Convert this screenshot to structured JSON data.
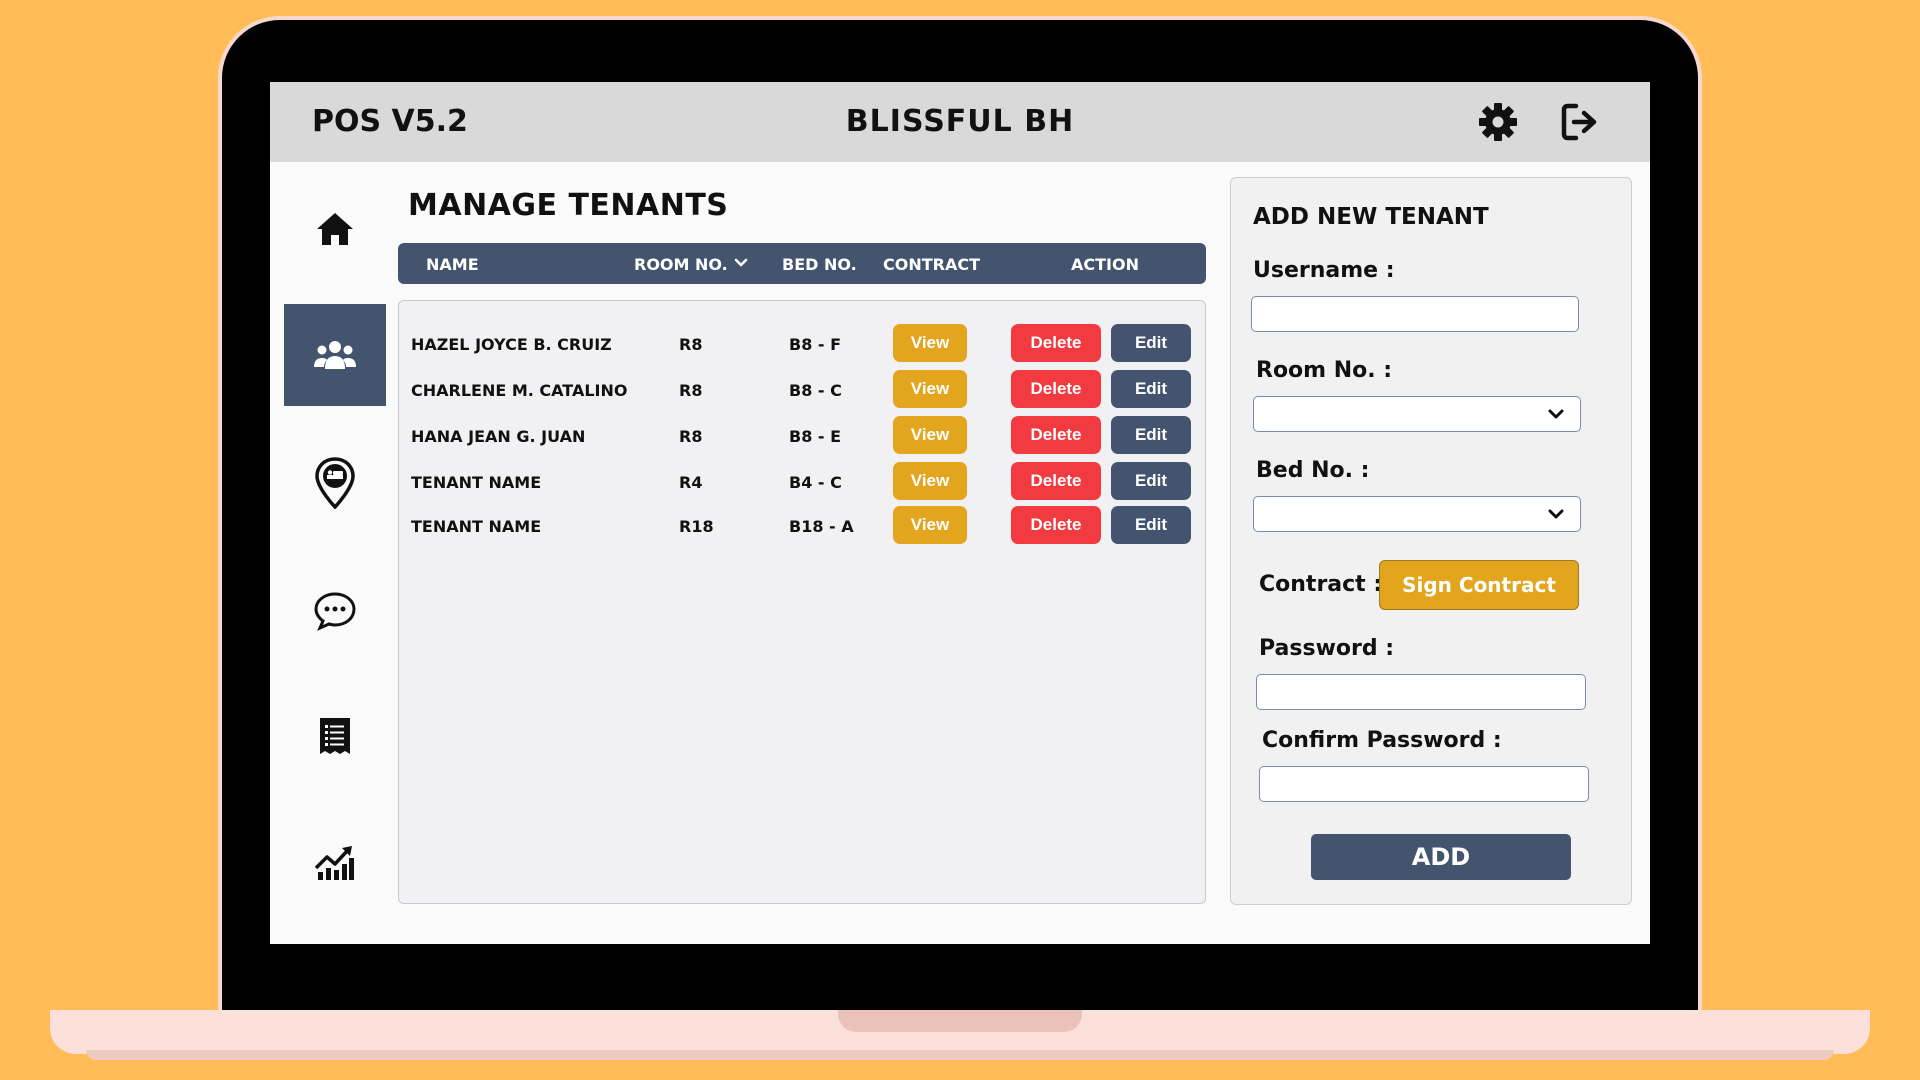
{
  "header": {
    "app_version": "POS V5.2",
    "brand": "BLISSFUL BH",
    "icons": [
      "gear-icon",
      "logout-icon"
    ]
  },
  "sidebar": {
    "items": [
      {
        "name": "home",
        "icon": "home-icon",
        "active": false
      },
      {
        "name": "tenants",
        "icon": "users-icon",
        "active": true
      },
      {
        "name": "rooms",
        "icon": "bed-location-icon",
        "active": false
      },
      {
        "name": "messages",
        "icon": "chat-icon",
        "active": false
      },
      {
        "name": "reports",
        "icon": "receipt-icon",
        "active": false
      },
      {
        "name": "analytics",
        "icon": "chart-icon",
        "active": false
      }
    ]
  },
  "main": {
    "title": "MANAGE TENANTS",
    "columns": {
      "name": "NAME",
      "room": "ROOM NO.",
      "bed": "BED NO.",
      "contract": "CONTRACT",
      "action": "ACTION"
    },
    "rows": [
      {
        "name": "HAZEL JOYCE B. CRUIZ",
        "room": "R8",
        "bed": "B8 - F",
        "view": "View",
        "delete": "Delete",
        "edit": "Edit"
      },
      {
        "name": "CHARLENE M. CATALINO",
        "room": "R8",
        "bed": "B8 - C",
        "view": "View",
        "delete": "Delete",
        "edit": "Edit"
      },
      {
        "name": "HANA JEAN G. JUAN",
        "room": "R8",
        "bed": "B8 - E",
        "view": "View",
        "delete": "Delete",
        "edit": "Edit"
      },
      {
        "name": "TENANT NAME",
        "room": "R4",
        "bed": "B4 - C",
        "view": "View",
        "delete": "Delete",
        "edit": "Edit"
      },
      {
        "name": "TENANT NAME",
        "room": "R18",
        "bed": "B18 - A",
        "view": "View",
        "delete": "Delete",
        "edit": "Edit"
      }
    ]
  },
  "form": {
    "title": "ADD NEW TENANT",
    "username_label": "Username :",
    "username_value": "",
    "room_label": "Room No. :",
    "room_value": "",
    "bed_label": "Bed No. :",
    "bed_value": "",
    "contract_label": "Contract :",
    "sign_button": "Sign Contract",
    "password_label": "Password :",
    "password_value": "",
    "confirm_label": "Confirm Password :",
    "confirm_value": "",
    "add_button": "ADD"
  },
  "colors": {
    "background": "#FFBC57",
    "navy": "#44546F",
    "view": "#E3A51E",
    "delete": "#F23B40",
    "topbar": "#D9D9D9"
  }
}
